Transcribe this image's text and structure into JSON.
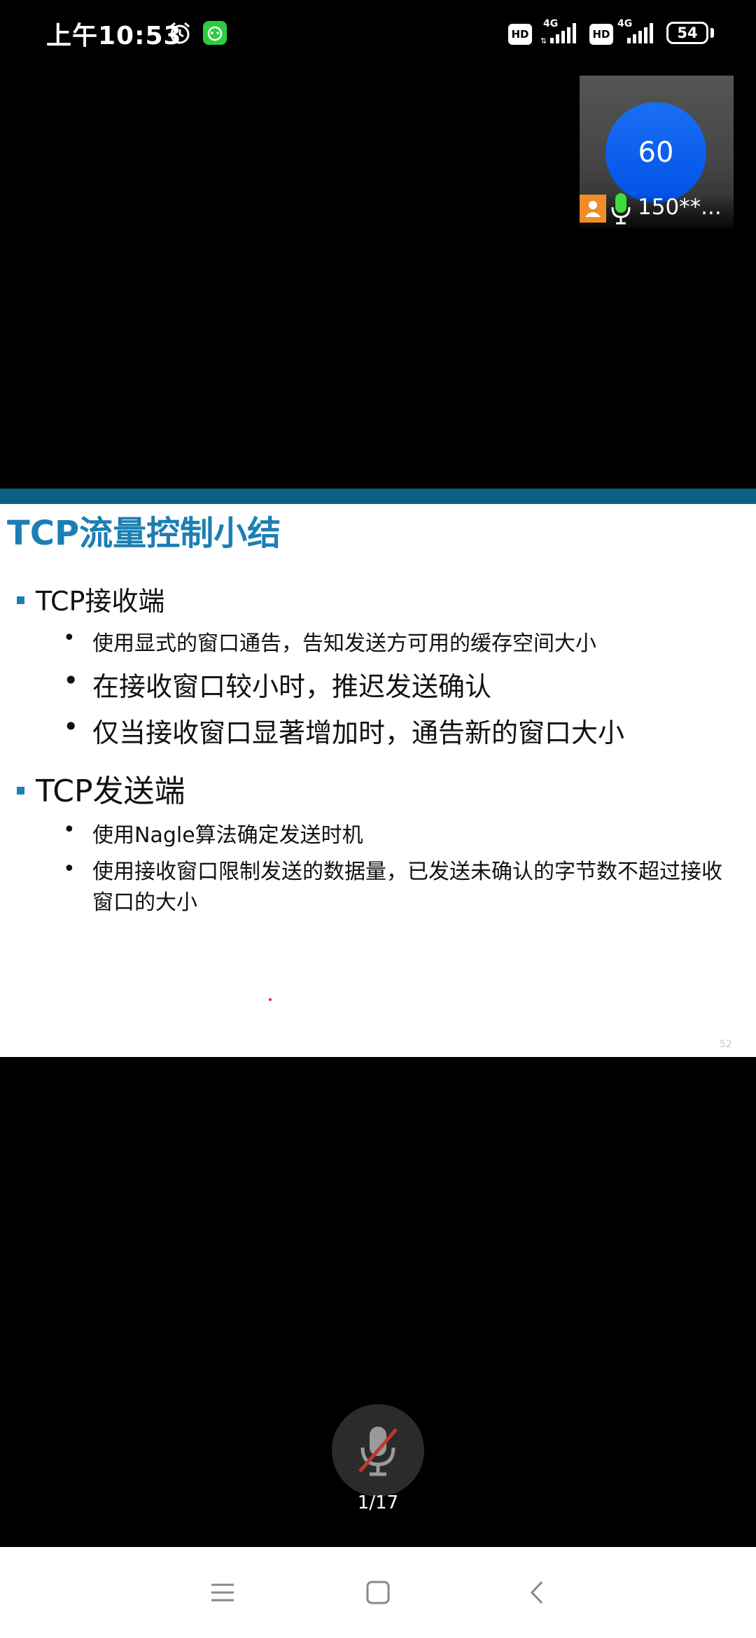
{
  "status_bar": {
    "time": "上午10:53",
    "sim1": {
      "hd": "HD",
      "network": "4G"
    },
    "sim2": {
      "hd": "HD",
      "network": "4G"
    },
    "battery": "54"
  },
  "participant": {
    "avatar_text": "60",
    "name": "150**..."
  },
  "slide": {
    "title": "TCP流量控制小结",
    "sections": [
      {
        "heading": "TCP接收端",
        "items": [
          "使用显式的窗口通告，告知发送方可用的缓存空间大小",
          "在接收窗口较小时，推迟发送确认",
          "仅当接收窗口显著增加时，通告新的窗口大小"
        ]
      },
      {
        "heading": "TCP发送端",
        "items": [
          "使用Nagle算法确定发送时机",
          "使用接收窗口限制发送的数据量，已发送未确认的字节数不超过接收窗口的大小"
        ]
      }
    ],
    "page_number": "52"
  },
  "controls": {
    "page_indicator": "1/17"
  },
  "colors": {
    "slide_accent": "#1a7fb4",
    "slide_topbar": "#0b6280",
    "avatar_blue": "#0a66f0"
  }
}
